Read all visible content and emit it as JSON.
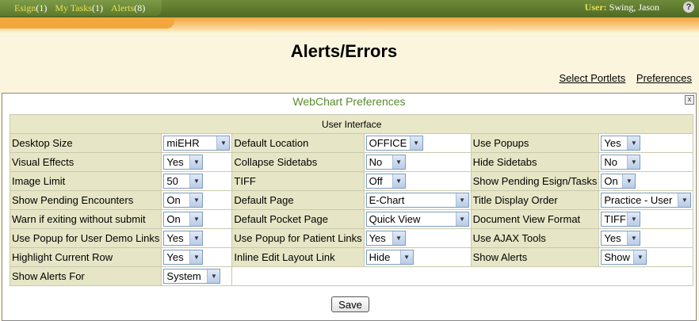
{
  "topbar": {
    "tabs": [
      {
        "label": "Esign",
        "count": "(1)"
      },
      {
        "label": "My Tasks",
        "count": "(1)"
      },
      {
        "label": "Alerts",
        "count": "(8)"
      }
    ],
    "user_label": "User:",
    "user_name": "Swing, Jason",
    "help_glyph": "?"
  },
  "page": {
    "title": "Alerts/Errors",
    "links": [
      "Select Portlets",
      "Preferences"
    ]
  },
  "portlet": {
    "title": "WebChart Preferences",
    "close_glyph": "x",
    "section_header": "User Interface",
    "rows": [
      [
        {
          "label": "Desktop Size",
          "value": "miEHR"
        },
        {
          "label": "Default Location",
          "value": "OFFICE"
        },
        {
          "label": "Use Popups",
          "value": "Yes"
        }
      ],
      [
        {
          "label": "Visual Effects",
          "value": "Yes"
        },
        {
          "label": "Collapse Sidetabs",
          "value": "No"
        },
        {
          "label": "Hide Sidetabs",
          "value": "No"
        }
      ],
      [
        {
          "label": "Image Limit",
          "value": "50"
        },
        {
          "label": "TIFF",
          "value": "Off"
        },
        {
          "label": "Show Pending Esign/Tasks",
          "value": "On"
        }
      ],
      [
        {
          "label": "Show Pending Encounters",
          "value": "On"
        },
        {
          "label": "Default Page",
          "value": "E-Chart"
        },
        {
          "label": "Title Display Order",
          "value": "Practice - User"
        }
      ],
      [
        {
          "label": "Warn if exiting without submit",
          "value": "On"
        },
        {
          "label": "Default Pocket Page",
          "value": "Quick View"
        },
        {
          "label": "Document View Format",
          "value": "TIFF"
        }
      ],
      [
        {
          "label": "Use Popup for User Demo Links",
          "value": "Yes"
        },
        {
          "label": "Use Popup for Patient Links",
          "value": "Yes"
        },
        {
          "label": "Use AJAX Tools",
          "value": "Yes"
        }
      ],
      [
        {
          "label": "Highlight Current Row",
          "value": "Yes"
        },
        {
          "label": "Inline Edit Layout Link",
          "value": "Hide"
        },
        {
          "label": "Show Alerts",
          "value": "Show"
        }
      ],
      [
        {
          "label": "Show Alerts For",
          "value": "System"
        }
      ]
    ],
    "save_label": "Save"
  }
}
